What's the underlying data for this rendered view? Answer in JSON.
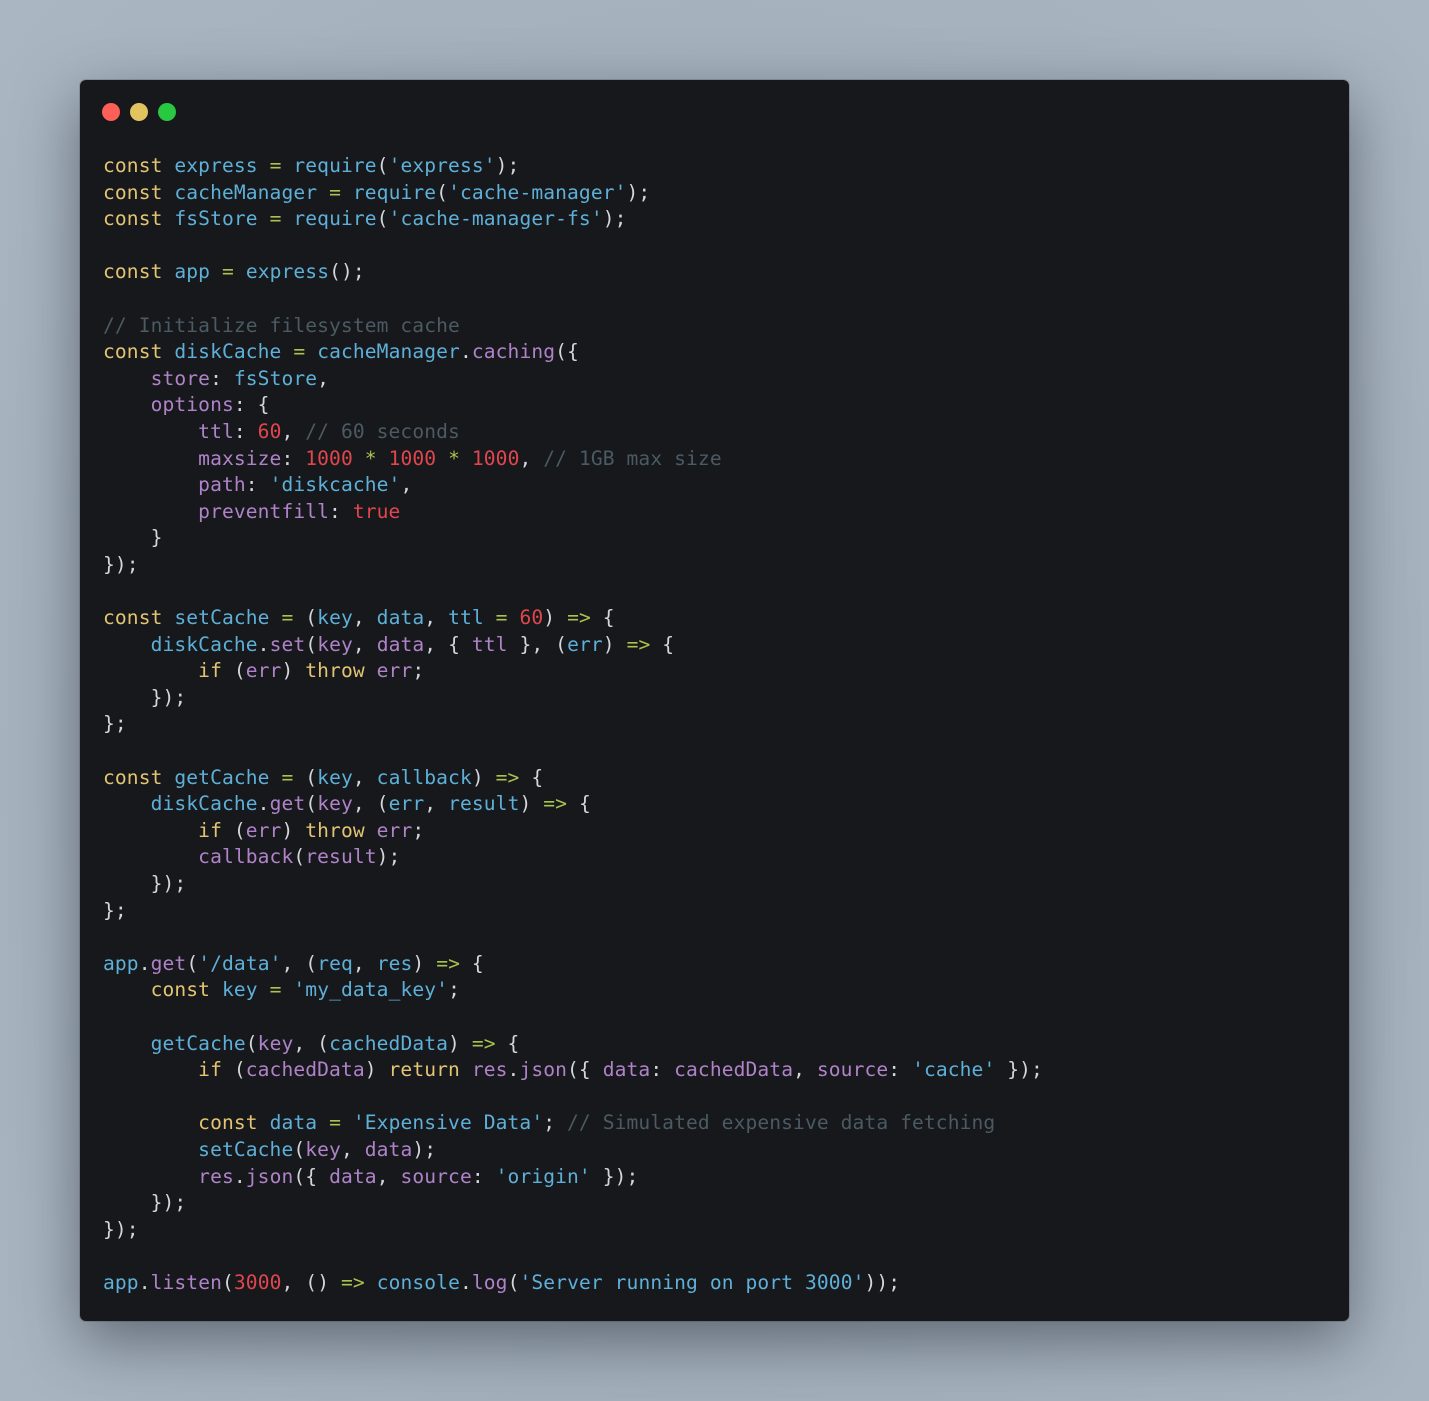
{
  "window": {
    "title_dots": [
      {
        "name": "close",
        "color": "#fe5f57"
      },
      {
        "name": "minimize",
        "color": "#e2c45e"
      },
      {
        "name": "maximize",
        "color": "#28c840"
      }
    ]
  },
  "theme": {
    "background": "#16181b",
    "keyword": "#e3c472",
    "identifier": "#5eb0d8",
    "operator": "#a8c34f",
    "property": "#b083c9",
    "number": "#e0464d",
    "string": "#5eb0d8",
    "comment": "#4b5a63"
  },
  "code": {
    "language": "javascript",
    "lines": [
      [
        [
          "kw",
          "const"
        ],
        [
          "pu",
          " "
        ],
        [
          "id",
          "express"
        ],
        [
          "pu",
          " "
        ],
        [
          "op",
          "="
        ],
        [
          "pu",
          " "
        ],
        [
          "id",
          "require"
        ],
        [
          "pu",
          "("
        ],
        [
          "st",
          "'express'"
        ],
        [
          "pu",
          ");"
        ]
      ],
      [
        [
          "kw",
          "const"
        ],
        [
          "pu",
          " "
        ],
        [
          "id",
          "cacheManager"
        ],
        [
          "pu",
          " "
        ],
        [
          "op",
          "="
        ],
        [
          "pu",
          " "
        ],
        [
          "id",
          "require"
        ],
        [
          "pu",
          "("
        ],
        [
          "st",
          "'cache-manager'"
        ],
        [
          "pu",
          ");"
        ]
      ],
      [
        [
          "kw",
          "const"
        ],
        [
          "pu",
          " "
        ],
        [
          "id",
          "fsStore"
        ],
        [
          "pu",
          " "
        ],
        [
          "op",
          "="
        ],
        [
          "pu",
          " "
        ],
        [
          "id",
          "require"
        ],
        [
          "pu",
          "("
        ],
        [
          "st",
          "'cache-manager-fs'"
        ],
        [
          "pu",
          ");"
        ]
      ],
      [],
      [
        [
          "kw",
          "const"
        ],
        [
          "pu",
          " "
        ],
        [
          "id",
          "app"
        ],
        [
          "pu",
          " "
        ],
        [
          "op",
          "="
        ],
        [
          "pu",
          " "
        ],
        [
          "id",
          "express"
        ],
        [
          "pu",
          "();"
        ]
      ],
      [],
      [
        [
          "cm",
          "// Initialize filesystem cache"
        ]
      ],
      [
        [
          "kw",
          "const"
        ],
        [
          "pu",
          " "
        ],
        [
          "id",
          "diskCache"
        ],
        [
          "pu",
          " "
        ],
        [
          "op",
          "="
        ],
        [
          "pu",
          " "
        ],
        [
          "id",
          "cacheManager"
        ],
        [
          "pu",
          "."
        ],
        [
          "pr",
          "caching"
        ],
        [
          "pu",
          "({"
        ]
      ],
      [
        [
          "pu",
          "    "
        ],
        [
          "pr",
          "store"
        ],
        [
          "pu",
          ": "
        ],
        [
          "id",
          "fsStore"
        ],
        [
          "pu",
          ","
        ]
      ],
      [
        [
          "pu",
          "    "
        ],
        [
          "pr",
          "options"
        ],
        [
          "pu",
          ": {"
        ]
      ],
      [
        [
          "pu",
          "        "
        ],
        [
          "pr",
          "ttl"
        ],
        [
          "pu",
          ": "
        ],
        [
          "nu",
          "60"
        ],
        [
          "pu",
          ", "
        ],
        [
          "cm",
          "// 60 seconds"
        ]
      ],
      [
        [
          "pu",
          "        "
        ],
        [
          "pr",
          "maxsize"
        ],
        [
          "pu",
          ": "
        ],
        [
          "nu",
          "1000"
        ],
        [
          "pu",
          " "
        ],
        [
          "op",
          "*"
        ],
        [
          "pu",
          " "
        ],
        [
          "nu",
          "1000"
        ],
        [
          "pu",
          " "
        ],
        [
          "op",
          "*"
        ],
        [
          "pu",
          " "
        ],
        [
          "nu",
          "1000"
        ],
        [
          "pu",
          ", "
        ],
        [
          "cm",
          "// 1GB max size"
        ]
      ],
      [
        [
          "pu",
          "        "
        ],
        [
          "pr",
          "path"
        ],
        [
          "pu",
          ": "
        ],
        [
          "st",
          "'diskcache'"
        ],
        [
          "pu",
          ","
        ]
      ],
      [
        [
          "pu",
          "        "
        ],
        [
          "pr",
          "preventfill"
        ],
        [
          "pu",
          ": "
        ],
        [
          "nu",
          "true"
        ]
      ],
      [
        [
          "pu",
          "    }"
        ]
      ],
      [
        [
          "pu",
          "});"
        ]
      ],
      [],
      [
        [
          "kw",
          "const"
        ],
        [
          "pu",
          " "
        ],
        [
          "id",
          "setCache"
        ],
        [
          "pu",
          " "
        ],
        [
          "op",
          "="
        ],
        [
          "pu",
          " ("
        ],
        [
          "id",
          "key"
        ],
        [
          "pu",
          ", "
        ],
        [
          "id",
          "data"
        ],
        [
          "pu",
          ", "
        ],
        [
          "id",
          "ttl"
        ],
        [
          "pu",
          " "
        ],
        [
          "op",
          "="
        ],
        [
          "pu",
          " "
        ],
        [
          "nu",
          "60"
        ],
        [
          "pu",
          ") "
        ],
        [
          "op",
          "=>"
        ],
        [
          "pu",
          " {"
        ]
      ],
      [
        [
          "pu",
          "    "
        ],
        [
          "id",
          "diskCache"
        ],
        [
          "pu",
          "."
        ],
        [
          "pr",
          "set"
        ],
        [
          "pu",
          "("
        ],
        [
          "pr",
          "key"
        ],
        [
          "pu",
          ", "
        ],
        [
          "pr",
          "data"
        ],
        [
          "pu",
          ", { "
        ],
        [
          "pr",
          "ttl"
        ],
        [
          "pu",
          " }, ("
        ],
        [
          "id",
          "err"
        ],
        [
          "pu",
          ") "
        ],
        [
          "op",
          "=>"
        ],
        [
          "pu",
          " {"
        ]
      ],
      [
        [
          "pu",
          "        "
        ],
        [
          "kw",
          "if"
        ],
        [
          "pu",
          " ("
        ],
        [
          "pr",
          "err"
        ],
        [
          "pu",
          ") "
        ],
        [
          "kw",
          "throw"
        ],
        [
          "pu",
          " "
        ],
        [
          "pr",
          "err"
        ],
        [
          "pu",
          ";"
        ]
      ],
      [
        [
          "pu",
          "    });"
        ]
      ],
      [
        [
          "pu",
          "};"
        ]
      ],
      [],
      [
        [
          "kw",
          "const"
        ],
        [
          "pu",
          " "
        ],
        [
          "id",
          "getCache"
        ],
        [
          "pu",
          " "
        ],
        [
          "op",
          "="
        ],
        [
          "pu",
          " ("
        ],
        [
          "id",
          "key"
        ],
        [
          "pu",
          ", "
        ],
        [
          "id",
          "callback"
        ],
        [
          "pu",
          ") "
        ],
        [
          "op",
          "=>"
        ],
        [
          "pu",
          " {"
        ]
      ],
      [
        [
          "pu",
          "    "
        ],
        [
          "id",
          "diskCache"
        ],
        [
          "pu",
          "."
        ],
        [
          "pr",
          "get"
        ],
        [
          "pu",
          "("
        ],
        [
          "pr",
          "key"
        ],
        [
          "pu",
          ", ("
        ],
        [
          "id",
          "err"
        ],
        [
          "pu",
          ", "
        ],
        [
          "id",
          "result"
        ],
        [
          "pu",
          ") "
        ],
        [
          "op",
          "=>"
        ],
        [
          "pu",
          " {"
        ]
      ],
      [
        [
          "pu",
          "        "
        ],
        [
          "kw",
          "if"
        ],
        [
          "pu",
          " ("
        ],
        [
          "pr",
          "err"
        ],
        [
          "pu",
          ") "
        ],
        [
          "kw",
          "throw"
        ],
        [
          "pu",
          " "
        ],
        [
          "pr",
          "err"
        ],
        [
          "pu",
          ";"
        ]
      ],
      [
        [
          "pu",
          "        "
        ],
        [
          "pr",
          "callback"
        ],
        [
          "pu",
          "("
        ],
        [
          "pr",
          "result"
        ],
        [
          "pu",
          ");"
        ]
      ],
      [
        [
          "pu",
          "    });"
        ]
      ],
      [
        [
          "pu",
          "};"
        ]
      ],
      [],
      [
        [
          "id",
          "app"
        ],
        [
          "pu",
          "."
        ],
        [
          "pr",
          "get"
        ],
        [
          "pu",
          "("
        ],
        [
          "st",
          "'/data'"
        ],
        [
          "pu",
          ", ("
        ],
        [
          "id",
          "req"
        ],
        [
          "pu",
          ", "
        ],
        [
          "id",
          "res"
        ],
        [
          "pu",
          ") "
        ],
        [
          "op",
          "=>"
        ],
        [
          "pu",
          " {"
        ]
      ],
      [
        [
          "pu",
          "    "
        ],
        [
          "kw",
          "const"
        ],
        [
          "pu",
          " "
        ],
        [
          "id",
          "key"
        ],
        [
          "pu",
          " "
        ],
        [
          "op",
          "="
        ],
        [
          "pu",
          " "
        ],
        [
          "st",
          "'my_data_key'"
        ],
        [
          "pu",
          ";"
        ]
      ],
      [],
      [
        [
          "pu",
          "    "
        ],
        [
          "id",
          "getCache"
        ],
        [
          "pu",
          "("
        ],
        [
          "pr",
          "key"
        ],
        [
          "pu",
          ", ("
        ],
        [
          "id",
          "cachedData"
        ],
        [
          "pu",
          ") "
        ],
        [
          "op",
          "=>"
        ],
        [
          "pu",
          " {"
        ]
      ],
      [
        [
          "pu",
          "        "
        ],
        [
          "kw",
          "if"
        ],
        [
          "pu",
          " ("
        ],
        [
          "pr",
          "cachedData"
        ],
        [
          "pu",
          ") "
        ],
        [
          "kw",
          "return"
        ],
        [
          "pu",
          " "
        ],
        [
          "pr",
          "res"
        ],
        [
          "pu",
          "."
        ],
        [
          "pr",
          "json"
        ],
        [
          "pu",
          "({ "
        ],
        [
          "pr",
          "data"
        ],
        [
          "pu",
          ": "
        ],
        [
          "pr",
          "cachedData"
        ],
        [
          "pu",
          ", "
        ],
        [
          "pr",
          "source"
        ],
        [
          "pu",
          ": "
        ],
        [
          "st",
          "'cache'"
        ],
        [
          "pu",
          " });"
        ]
      ],
      [],
      [
        [
          "pu",
          "        "
        ],
        [
          "kw",
          "const"
        ],
        [
          "pu",
          " "
        ],
        [
          "id",
          "data"
        ],
        [
          "pu",
          " "
        ],
        [
          "op",
          "="
        ],
        [
          "pu",
          " "
        ],
        [
          "st",
          "'Expensive Data'"
        ],
        [
          "pu",
          "; "
        ],
        [
          "cm",
          "// Simulated expensive data fetching"
        ]
      ],
      [
        [
          "pu",
          "        "
        ],
        [
          "id",
          "setCache"
        ],
        [
          "pu",
          "("
        ],
        [
          "pr",
          "key"
        ],
        [
          "pu",
          ", "
        ],
        [
          "pr",
          "data"
        ],
        [
          "pu",
          ");"
        ]
      ],
      [
        [
          "pu",
          "        "
        ],
        [
          "pr",
          "res"
        ],
        [
          "pu",
          "."
        ],
        [
          "pr",
          "json"
        ],
        [
          "pu",
          "({ "
        ],
        [
          "pr",
          "data"
        ],
        [
          "pu",
          ", "
        ],
        [
          "pr",
          "source"
        ],
        [
          "pu",
          ": "
        ],
        [
          "st",
          "'origin'"
        ],
        [
          "pu",
          " });"
        ]
      ],
      [
        [
          "pu",
          "    });"
        ]
      ],
      [
        [
          "pu",
          "});"
        ]
      ],
      [],
      [
        [
          "id",
          "app"
        ],
        [
          "pu",
          "."
        ],
        [
          "pr",
          "listen"
        ],
        [
          "pu",
          "("
        ],
        [
          "nu",
          "3000"
        ],
        [
          "pu",
          ", () "
        ],
        [
          "op",
          "=>"
        ],
        [
          "pu",
          " "
        ],
        [
          "id",
          "console"
        ],
        [
          "pu",
          "."
        ],
        [
          "pr",
          "log"
        ],
        [
          "pu",
          "("
        ],
        [
          "st",
          "'Server running on port 3000'"
        ],
        [
          "pu",
          "));"
        ]
      ]
    ]
  }
}
